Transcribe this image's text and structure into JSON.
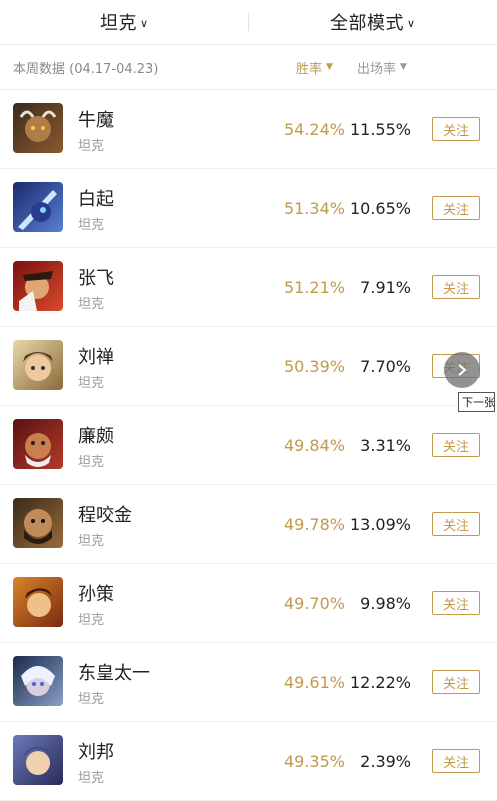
{
  "header": {
    "role_filter": "坦克",
    "mode_filter": "全部模式"
  },
  "subheader": {
    "week_label": "本周数据 (04.17-04.23)",
    "win_rate_sort": "胜率",
    "pick_rate_sort": "出场率"
  },
  "heroes": [
    {
      "name": "牛魔",
      "role": "坦克",
      "win_rate": "54.24%",
      "pick_rate": "11.55%",
      "follow": "关注"
    },
    {
      "name": "白起",
      "role": "坦克",
      "win_rate": "51.34%",
      "pick_rate": "10.65%",
      "follow": "关注"
    },
    {
      "name": "张飞",
      "role": "坦克",
      "win_rate": "51.21%",
      "pick_rate": "7.91%",
      "follow": "关注"
    },
    {
      "name": "刘禅",
      "role": "坦克",
      "win_rate": "50.39%",
      "pick_rate": "7.70%",
      "follow": "关注"
    },
    {
      "name": "廉颇",
      "role": "坦克",
      "win_rate": "49.84%",
      "pick_rate": "3.31%",
      "follow": "关注"
    },
    {
      "name": "程咬金",
      "role": "坦克",
      "win_rate": "49.78%",
      "pick_rate": "13.09%",
      "follow": "关注"
    },
    {
      "name": "孙策",
      "role": "坦克",
      "win_rate": "49.70%",
      "pick_rate": "9.98%",
      "follow": "关注"
    },
    {
      "name": "东皇太一",
      "role": "坦克",
      "win_rate": "49.61%",
      "pick_rate": "12.22%",
      "follow": "关注"
    },
    {
      "name": "刘邦",
      "role": "坦克",
      "win_rate": "49.35%",
      "pick_rate": "2.39%",
      "follow": "关注"
    }
  ],
  "overlay": {
    "next_tooltip": "下一张"
  },
  "colors": {
    "accent": "#c19a4c",
    "text": "#222222",
    "muted": "#999999"
  }
}
